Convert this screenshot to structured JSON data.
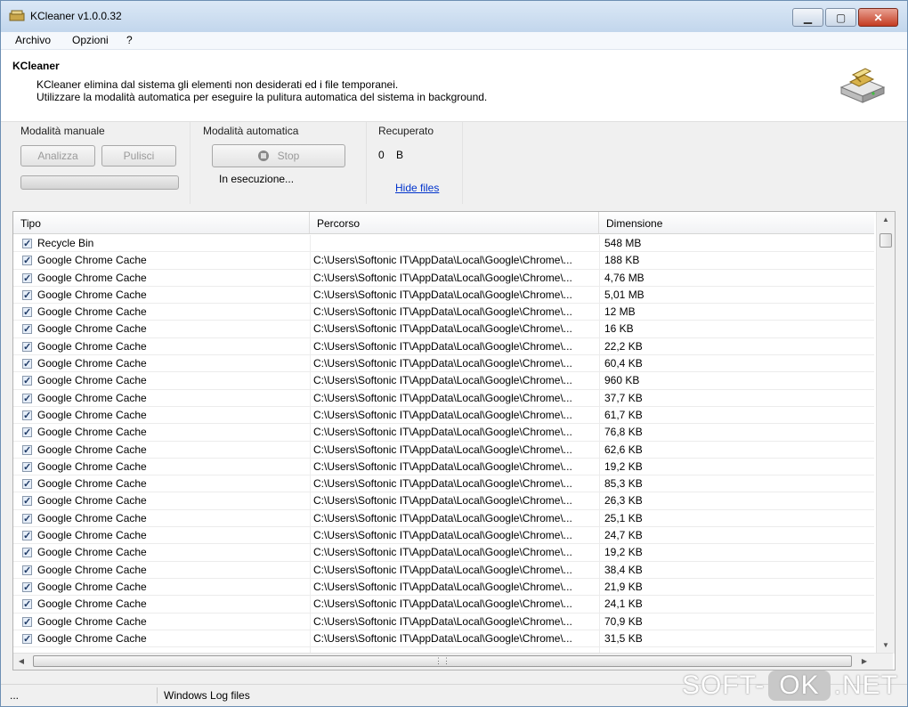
{
  "window": {
    "title": "KCleaner v1.0.0.32"
  },
  "menu": {
    "items": [
      "Archivo",
      "Opzioni",
      "?"
    ]
  },
  "header": {
    "title": "KCleaner",
    "line1": "KCleaner elimina dal sistema gli elementi non desiderati ed i file temporanei.",
    "line2": "Utilizzare la modalità automatica per eseguire la pulitura automatica del sistema in background."
  },
  "manual": {
    "label": "Modalità manuale",
    "analyze_label": "Analizza",
    "clean_label": "Pulisci"
  },
  "auto": {
    "label": "Modalità automatica",
    "stop_label": "Stop",
    "status": "In esecuzione..."
  },
  "recovered": {
    "label": "Recuperato",
    "value": "0",
    "unit": "B",
    "hide_link": "Hide files"
  },
  "table": {
    "columns": [
      "Tipo",
      "Percorso",
      "Dimensione"
    ],
    "rows": [
      {
        "type": "Recycle Bin",
        "path": "",
        "size": "548 MB"
      },
      {
        "type": "Google Chrome Cache",
        "path": "C:\\Users\\Softonic IT\\AppData\\Local\\Google\\Chrome\\...",
        "size": "188 KB"
      },
      {
        "type": "Google Chrome Cache",
        "path": "C:\\Users\\Softonic IT\\AppData\\Local\\Google\\Chrome\\...",
        "size": "4,76 MB"
      },
      {
        "type": "Google Chrome Cache",
        "path": "C:\\Users\\Softonic IT\\AppData\\Local\\Google\\Chrome\\...",
        "size": "5,01 MB"
      },
      {
        "type": "Google Chrome Cache",
        "path": "C:\\Users\\Softonic IT\\AppData\\Local\\Google\\Chrome\\...",
        "size": "12 MB"
      },
      {
        "type": "Google Chrome Cache",
        "path": "C:\\Users\\Softonic IT\\AppData\\Local\\Google\\Chrome\\...",
        "size": "16 KB"
      },
      {
        "type": "Google Chrome Cache",
        "path": "C:\\Users\\Softonic IT\\AppData\\Local\\Google\\Chrome\\...",
        "size": "22,2 KB"
      },
      {
        "type": "Google Chrome Cache",
        "path": "C:\\Users\\Softonic IT\\AppData\\Local\\Google\\Chrome\\...",
        "size": "60,4 KB"
      },
      {
        "type": "Google Chrome Cache",
        "path": "C:\\Users\\Softonic IT\\AppData\\Local\\Google\\Chrome\\...",
        "size": "960 KB"
      },
      {
        "type": "Google Chrome Cache",
        "path": "C:\\Users\\Softonic IT\\AppData\\Local\\Google\\Chrome\\...",
        "size": "37,7 KB"
      },
      {
        "type": "Google Chrome Cache",
        "path": "C:\\Users\\Softonic IT\\AppData\\Local\\Google\\Chrome\\...",
        "size": "61,7 KB"
      },
      {
        "type": "Google Chrome Cache",
        "path": "C:\\Users\\Softonic IT\\AppData\\Local\\Google\\Chrome\\...",
        "size": "76,8 KB"
      },
      {
        "type": "Google Chrome Cache",
        "path": "C:\\Users\\Softonic IT\\AppData\\Local\\Google\\Chrome\\...",
        "size": "62,6 KB"
      },
      {
        "type": "Google Chrome Cache",
        "path": "C:\\Users\\Softonic IT\\AppData\\Local\\Google\\Chrome\\...",
        "size": "19,2 KB"
      },
      {
        "type": "Google Chrome Cache",
        "path": "C:\\Users\\Softonic IT\\AppData\\Local\\Google\\Chrome\\...",
        "size": "85,3 KB"
      },
      {
        "type": "Google Chrome Cache",
        "path": "C:\\Users\\Softonic IT\\AppData\\Local\\Google\\Chrome\\...",
        "size": "26,3 KB"
      },
      {
        "type": "Google Chrome Cache",
        "path": "C:\\Users\\Softonic IT\\AppData\\Local\\Google\\Chrome\\...",
        "size": "25,1 KB"
      },
      {
        "type": "Google Chrome Cache",
        "path": "C:\\Users\\Softonic IT\\AppData\\Local\\Google\\Chrome\\...",
        "size": "24,7 KB"
      },
      {
        "type": "Google Chrome Cache",
        "path": "C:\\Users\\Softonic IT\\AppData\\Local\\Google\\Chrome\\...",
        "size": "19,2 KB"
      },
      {
        "type": "Google Chrome Cache",
        "path": "C:\\Users\\Softonic IT\\AppData\\Local\\Google\\Chrome\\...",
        "size": "38,4 KB"
      },
      {
        "type": "Google Chrome Cache",
        "path": "C:\\Users\\Softonic IT\\AppData\\Local\\Google\\Chrome\\...",
        "size": "21,9 KB"
      },
      {
        "type": "Google Chrome Cache",
        "path": "C:\\Users\\Softonic IT\\AppData\\Local\\Google\\Chrome\\...",
        "size": "24,1 KB"
      },
      {
        "type": "Google Chrome Cache",
        "path": "C:\\Users\\Softonic IT\\AppData\\Local\\Google\\Chrome\\...",
        "size": "70,9 KB"
      },
      {
        "type": "Google Chrome Cache",
        "path": "C:\\Users\\Softonic IT\\AppData\\Local\\Google\\Chrome\\...",
        "size": "31,5 KB"
      }
    ]
  },
  "status": {
    "left": "...",
    "right": "Windows Log files"
  },
  "watermark": {
    "part1": "SOFT-",
    "part2": "OK",
    "part3": ".NET"
  },
  "icons": {
    "app": "kcleaner-app-icon",
    "header": "hard-drive-icon",
    "stop": "stop-icon",
    "checkbox": "checkbox-checked-icon"
  },
  "colors": {
    "link": "#0033cc",
    "title_bar": "#c2d6ec",
    "close_button": "#c43b21"
  }
}
